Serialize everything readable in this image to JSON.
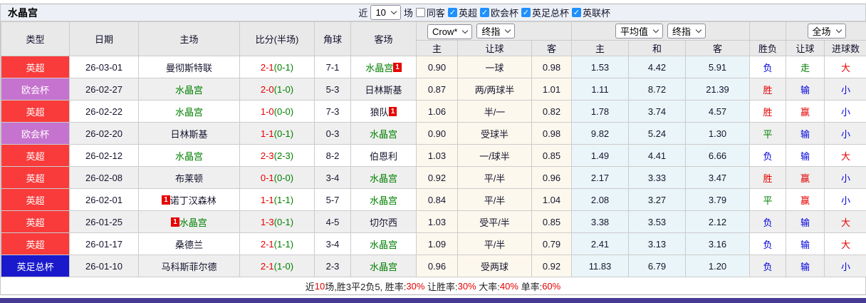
{
  "title": "水晶宫",
  "controls": {
    "recent_label": "近",
    "matches_count": "10",
    "matches_label": "场",
    "filters": [
      {
        "label": "同客",
        "checked": false
      },
      {
        "label": "英超",
        "checked": true
      },
      {
        "label": "欧会杯",
        "checked": true
      },
      {
        "label": "英足总杯",
        "checked": true
      },
      {
        "label": "英联杯",
        "checked": true
      }
    ]
  },
  "header": {
    "cols": [
      "类型",
      "日期",
      "主场",
      "比分(半场)",
      "角球",
      "客场"
    ],
    "selects": {
      "odds_company": "Crow*",
      "odds_stage": "终指",
      "avg_source": "平均值",
      "avg_stage": "终指",
      "scope": "全场"
    },
    "sub": [
      "主",
      "让球",
      "客",
      "主",
      "和",
      "客",
      "胜负",
      "让球",
      "进球数"
    ]
  },
  "colors": {
    "league_epl": "#f93b3b",
    "league_uecl": "#c573ce",
    "league_facup": "#1a1acc",
    "text_red": "#e60000",
    "text_green": "#008000",
    "text_blue": "#0000dd",
    "checkbox_blue": "#1e90ff",
    "asia_bg": "#fdf8ed",
    "avg_bg": "#eaf5f9",
    "bottom_bar": "#463a94"
  },
  "rows": [
    {
      "league": "英超",
      "league_variant": "epl",
      "date": "26-03-01",
      "home": "曼彻斯特联",
      "home_tone": "dark",
      "home_card": null,
      "score_ft": "2-1",
      "score_ht": "(0-1)",
      "corners": "7-1",
      "away": "水晶宫",
      "away_tone": "green",
      "away_card": "1",
      "asia_home": "0.90",
      "asia_line": "一球",
      "asia_away": "0.98",
      "avg_home": "1.53",
      "avg_draw": "4.42",
      "avg_away": "5.91",
      "result": "负",
      "result_tone": "blue",
      "handicap_result": "走",
      "handicap_tone": "green",
      "goals_result": "大",
      "goals_tone": "red"
    },
    {
      "league": "欧会杯",
      "league_variant": "uecl",
      "date": "26-02-27",
      "home": "水晶宫",
      "home_tone": "green",
      "home_card": null,
      "score_ft": "2-0",
      "score_ht": "(1-0)",
      "corners": "5-3",
      "away": "日林斯基",
      "away_tone": "dark",
      "away_card": null,
      "asia_home": "0.87",
      "asia_line": "两/两球半",
      "asia_away": "1.01",
      "avg_home": "1.11",
      "avg_draw": "8.72",
      "avg_away": "21.39",
      "result": "胜",
      "result_tone": "red",
      "handicap_result": "输",
      "handicap_tone": "blue",
      "goals_result": "小",
      "goals_tone": "blue"
    },
    {
      "league": "英超",
      "league_variant": "epl",
      "date": "26-02-22",
      "home": "水晶宫",
      "home_tone": "green",
      "home_card": null,
      "score_ft": "1-0",
      "score_ht": "(0-0)",
      "corners": "7-3",
      "away": "狼队",
      "away_tone": "dark",
      "away_card": "1",
      "asia_home": "1.06",
      "asia_line": "半/一",
      "asia_away": "0.82",
      "avg_home": "1.78",
      "avg_draw": "3.74",
      "avg_away": "4.57",
      "result": "胜",
      "result_tone": "red",
      "handicap_result": "赢",
      "handicap_tone": "red",
      "goals_result": "小",
      "goals_tone": "blue"
    },
    {
      "league": "欧会杯",
      "league_variant": "uecl",
      "date": "26-02-20",
      "home": "日林斯基",
      "home_tone": "dark",
      "home_card": null,
      "score_ft": "1-1",
      "score_ht": "(0-1)",
      "corners": "0-3",
      "away": "水晶宫",
      "away_tone": "green",
      "away_card": null,
      "asia_home": "0.90",
      "asia_line": "受球半",
      "asia_away": "0.98",
      "avg_home": "9.82",
      "avg_draw": "5.24",
      "avg_away": "1.30",
      "result": "平",
      "result_tone": "green",
      "handicap_result": "输",
      "handicap_tone": "blue",
      "goals_result": "小",
      "goals_tone": "blue"
    },
    {
      "league": "英超",
      "league_variant": "epl",
      "date": "26-02-12",
      "home": "水晶宫",
      "home_tone": "green",
      "home_card": null,
      "score_ft": "2-3",
      "score_ht": "(2-3)",
      "corners": "8-2",
      "away": "伯恩利",
      "away_tone": "dark",
      "away_card": null,
      "asia_home": "1.03",
      "asia_line": "一/球半",
      "asia_away": "0.85",
      "avg_home": "1.49",
      "avg_draw": "4.41",
      "avg_away": "6.66",
      "result": "负",
      "result_tone": "blue",
      "handicap_result": "输",
      "handicap_tone": "blue",
      "goals_result": "大",
      "goals_tone": "red"
    },
    {
      "league": "英超",
      "league_variant": "epl",
      "date": "26-02-08",
      "home": "布莱顿",
      "home_tone": "dark",
      "home_card": null,
      "score_ft": "0-1",
      "score_ht": "(0-0)",
      "corners": "3-4",
      "away": "水晶宫",
      "away_tone": "green",
      "away_card": null,
      "asia_home": "0.92",
      "asia_line": "平/半",
      "asia_away": "0.96",
      "avg_home": "2.17",
      "avg_draw": "3.33",
      "avg_away": "3.47",
      "result": "胜",
      "result_tone": "red",
      "handicap_result": "赢",
      "handicap_tone": "red",
      "goals_result": "小",
      "goals_tone": "blue"
    },
    {
      "league": "英超",
      "league_variant": "epl",
      "date": "26-02-01",
      "home": "诺丁汉森林",
      "home_tone": "dark",
      "home_card": "1",
      "score_ft": "1-1",
      "score_ht": "(1-1)",
      "corners": "5-7",
      "away": "水晶宫",
      "away_tone": "green",
      "away_card": null,
      "asia_home": "0.84",
      "asia_line": "平/半",
      "asia_away": "1.04",
      "avg_home": "2.08",
      "avg_draw": "3.27",
      "avg_away": "3.79",
      "result": "平",
      "result_tone": "green",
      "handicap_result": "赢",
      "handicap_tone": "red",
      "goals_result": "小",
      "goals_tone": "blue"
    },
    {
      "league": "英超",
      "league_variant": "epl",
      "date": "26-01-25",
      "home": "水晶宫",
      "home_tone": "green",
      "home_card": "1",
      "score_ft": "1-3",
      "score_ht": "(0-1)",
      "corners": "4-5",
      "away": "切尔西",
      "away_tone": "dark",
      "away_card": null,
      "asia_home": "1.03",
      "asia_line": "受平/半",
      "asia_away": "0.85",
      "avg_home": "3.38",
      "avg_draw": "3.53",
      "avg_away": "2.12",
      "result": "负",
      "result_tone": "blue",
      "handicap_result": "输",
      "handicap_tone": "blue",
      "goals_result": "大",
      "goals_tone": "red"
    },
    {
      "league": "英超",
      "league_variant": "epl",
      "date": "26-01-17",
      "home": "桑德兰",
      "home_tone": "dark",
      "home_card": null,
      "score_ft": "2-1",
      "score_ht": "(1-1)",
      "corners": "3-4",
      "away": "水晶宫",
      "away_tone": "green",
      "away_card": null,
      "asia_home": "1.09",
      "asia_line": "平/半",
      "asia_away": "0.79",
      "avg_home": "2.41",
      "avg_draw": "3.13",
      "avg_away": "3.16",
      "result": "负",
      "result_tone": "blue",
      "handicap_result": "输",
      "handicap_tone": "blue",
      "goals_result": "大",
      "goals_tone": "red"
    },
    {
      "league": "英足总杯",
      "league_variant": "facup",
      "date": "26-01-10",
      "home": "马科斯菲尔德",
      "home_tone": "dark",
      "home_card": null,
      "score_ft": "2-1",
      "score_ht": "(1-0)",
      "corners": "2-3",
      "away": "水晶宫",
      "away_tone": "green",
      "away_card": null,
      "asia_home": "0.96",
      "asia_line": "受两球",
      "asia_away": "0.92",
      "avg_home": "11.83",
      "avg_draw": "6.79",
      "avg_away": "1.20",
      "result": "负",
      "result_tone": "blue",
      "handicap_result": "输",
      "handicap_tone": "blue",
      "goals_result": "小",
      "goals_tone": "blue"
    }
  ],
  "footer": {
    "parts": [
      {
        "text": "近",
        "tone": "dark"
      },
      {
        "text": "10",
        "tone": "red"
      },
      {
        "text": "场,胜3平2负5, 胜率:",
        "tone": "dark"
      },
      {
        "text": "30%",
        "tone": "red"
      },
      {
        "text": " 让胜率:",
        "tone": "dark"
      },
      {
        "text": "30%",
        "tone": "red"
      },
      {
        "text": " 大率:",
        "tone": "dark"
      },
      {
        "text": "40%",
        "tone": "red"
      },
      {
        "text": " 单率:",
        "tone": "dark"
      },
      {
        "text": "60%",
        "tone": "red"
      }
    ]
  }
}
